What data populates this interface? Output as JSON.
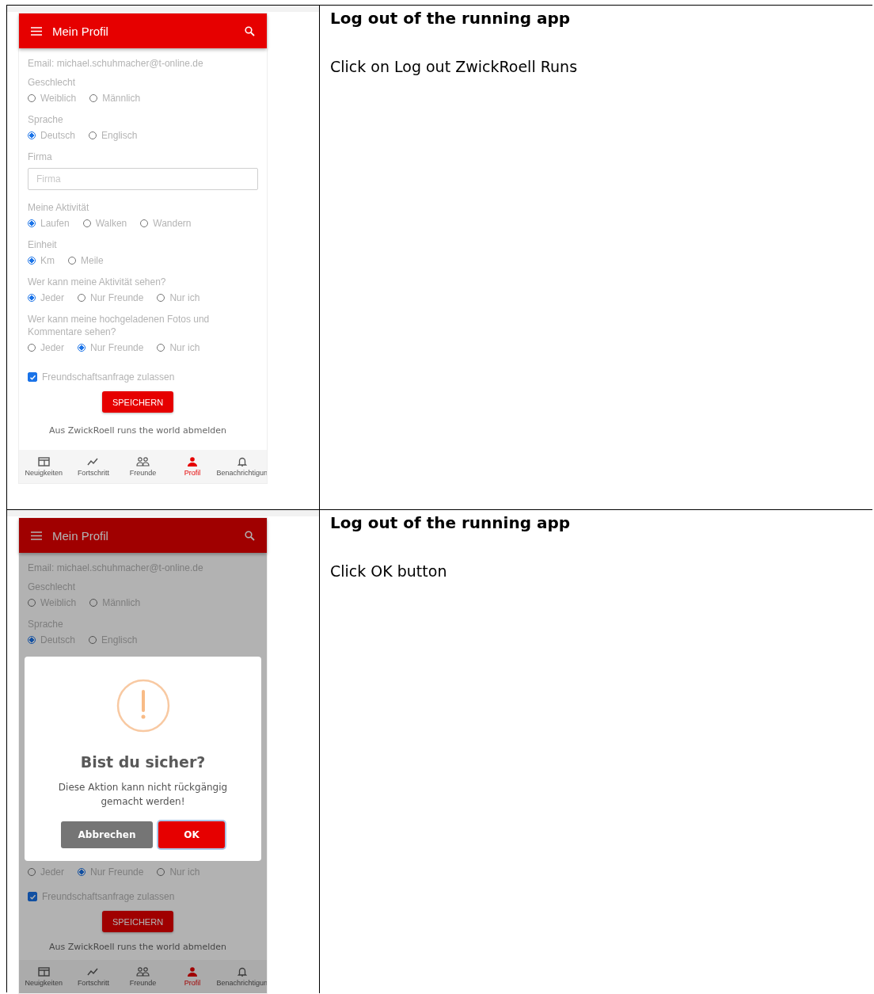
{
  "steps": [
    {
      "heading": "Log out of the running app",
      "instruction": "Click on Log out ZwickRoell Runs",
      "screen": {
        "title": "Mein Profil",
        "dimmed": false,
        "items": [
          {
            "kind": "text",
            "text": "Email: michael.schuhmacher@t-online.de"
          },
          {
            "kind": "label",
            "text": "Geschlecht"
          },
          {
            "kind": "radios",
            "options": [
              {
                "label": "Weiblich",
                "selected": false
              },
              {
                "label": "Männlich",
                "selected": false
              }
            ]
          },
          {
            "kind": "label",
            "text": "Sprache"
          },
          {
            "kind": "radios",
            "options": [
              {
                "label": "Deutsch",
                "selected": true
              },
              {
                "label": "Englisch",
                "selected": false
              }
            ]
          },
          {
            "kind": "label",
            "text": "Firma"
          },
          {
            "kind": "input",
            "placeholder": "Firma"
          },
          {
            "kind": "label",
            "text": "Meine Aktivität"
          },
          {
            "kind": "radios",
            "options": [
              {
                "label": "Laufen",
                "selected": true
              },
              {
                "label": "Walken",
                "selected": false
              },
              {
                "label": "Wandern",
                "selected": false
              }
            ]
          },
          {
            "kind": "label",
            "text": "Einheit"
          },
          {
            "kind": "radios",
            "options": [
              {
                "label": "Km",
                "selected": true
              },
              {
                "label": "Meile",
                "selected": false
              }
            ]
          },
          {
            "kind": "label",
            "text": "Wer kann meine Aktivität sehen?"
          },
          {
            "kind": "radios",
            "options": [
              {
                "label": "Jeder",
                "selected": true
              },
              {
                "label": "Nur Freunde",
                "selected": false
              },
              {
                "label": "Nur ich",
                "selected": false
              }
            ]
          },
          {
            "kind": "label",
            "text": "Wer kann meine hochgeladenen Fotos und Kommentare sehen?"
          },
          {
            "kind": "radios",
            "options": [
              {
                "label": "Jeder",
                "selected": false
              },
              {
                "label": "Nur Freunde",
                "selected": true
              },
              {
                "label": "Nur ich",
                "selected": false
              }
            ]
          },
          {
            "kind": "checkbox",
            "label": "Freundschaftsanfrage zulassen",
            "checked": true
          },
          {
            "kind": "button",
            "label": "SPEICHERN"
          },
          {
            "kind": "link",
            "text": "Aus ZwickRoell runs the world abmelden"
          }
        ],
        "nav": [
          {
            "label": "Neuigkeiten",
            "selected": false
          },
          {
            "label": "Fortschritt",
            "selected": false
          },
          {
            "label": "Freunde",
            "selected": false
          },
          {
            "label": "Profil",
            "selected": true
          },
          {
            "label": "Benachrichtigun",
            "selected": false
          }
        ]
      }
    },
    {
      "heading": "Log out of the running app",
      "instruction": "Click OK button",
      "screen": {
        "title": "Mein Profil",
        "dimmed": true,
        "items": [
          {
            "kind": "text",
            "text": "Email: michael.schuhmacher@t-online.de"
          },
          {
            "kind": "label",
            "text": "Geschlecht"
          },
          {
            "kind": "radios",
            "options": [
              {
                "label": "Weiblich",
                "selected": false
              },
              {
                "label": "Männlich",
                "selected": false
              }
            ]
          },
          {
            "kind": "label",
            "text": "Sprache"
          },
          {
            "kind": "radios",
            "options": [
              {
                "label": "Deutsch",
                "selected": true
              },
              {
                "label": "Englisch",
                "selected": false
              }
            ]
          },
          {
            "kind": "dialog",
            "title": "Bist du sicher?",
            "message": "Diese Aktion kann nicht rückgängig gemacht werden!",
            "cancel": "Abbrechen",
            "confirm": "OK"
          },
          {
            "kind": "radios",
            "options": [
              {
                "label": "Jeder",
                "selected": false
              },
              {
                "label": "Nur Freunde",
                "selected": true
              },
              {
                "label": "Nur ich",
                "selected": false
              }
            ]
          },
          {
            "kind": "checkbox",
            "label": "Freundschaftsanfrage zulassen",
            "checked": true
          },
          {
            "kind": "button",
            "label": "SPEICHERN"
          },
          {
            "kind": "link",
            "text": "Aus ZwickRoell runs the world abmelden"
          }
        ],
        "nav": [
          {
            "label": "Neuigkeiten",
            "selected": false
          },
          {
            "label": "Fortschritt",
            "selected": false
          },
          {
            "label": "Freunde",
            "selected": false
          },
          {
            "label": "Profil",
            "selected": true
          },
          {
            "label": "Benachrichtigun",
            "selected": false
          }
        ]
      }
    }
  ]
}
